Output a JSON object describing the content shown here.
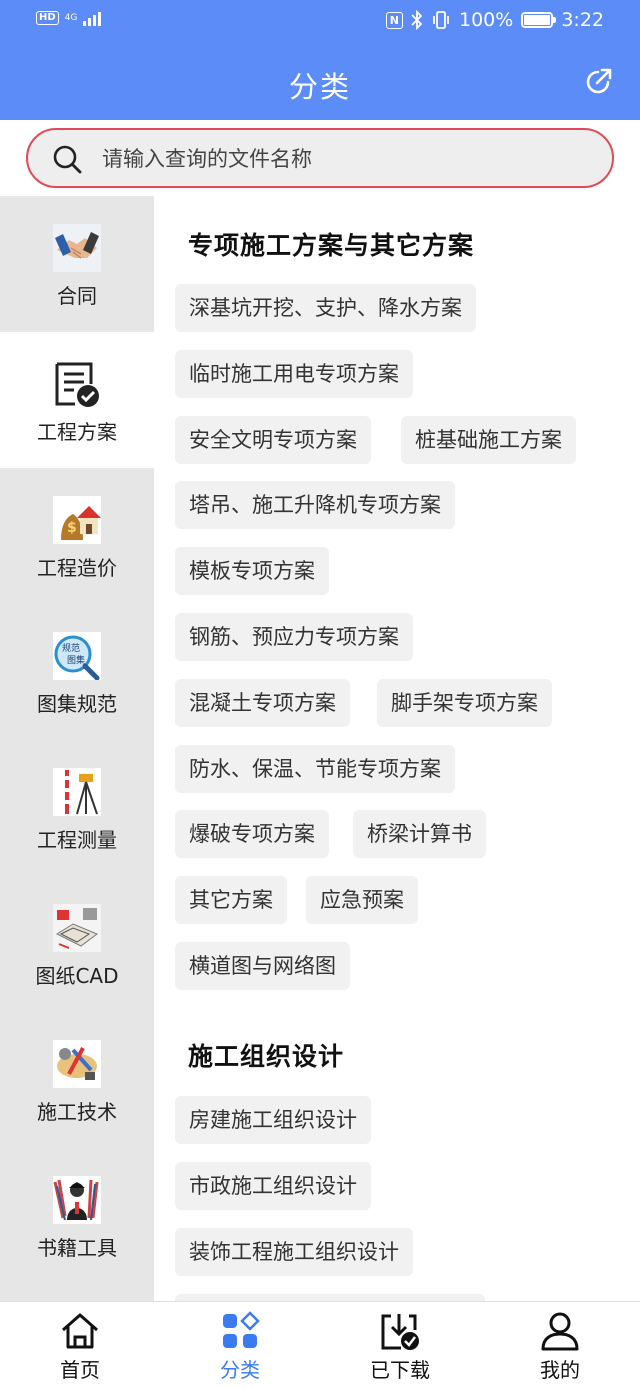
{
  "status_bar": {
    "hd": "HD",
    "network": "4G",
    "battery": "100%",
    "battery_level": 1.0,
    "time": "3:22"
  },
  "header": {
    "title": "分类",
    "share_icon": "share-icon"
  },
  "search": {
    "placeholder": "请输入查询的文件名称",
    "border_color": "#e24a55"
  },
  "sidebar": {
    "items": [
      {
        "label": "合同",
        "icon": "handshake-icon"
      },
      {
        "label": "工程方案",
        "icon": "document-check-icon"
      },
      {
        "label": "工程造价",
        "icon": "money-house-icon"
      },
      {
        "label": "图集规范",
        "icon": "atlas-spec-icon"
      },
      {
        "label": "工程测量",
        "icon": "survey-tripod-icon"
      },
      {
        "label": "图纸CAD",
        "icon": "cad-drawing-icon"
      },
      {
        "label": "施工技术",
        "icon": "construction-tools-icon"
      },
      {
        "label": "书籍工具",
        "icon": "books-icon"
      }
    ],
    "active_index": 1
  },
  "content": {
    "sections": [
      {
        "title": "专项施工方案与其它方案",
        "chips": [
          "深基坑开挖、支护、降水方案",
          "临时施工用电专项方案",
          "安全文明专项方案",
          "桩基础施工方案",
          "塔吊、施工升降机专项方案",
          "模板专项方案",
          "钢筋、预应力专项方案",
          "混凝土专项方案",
          "脚手架专项方案",
          "防水、保温、节能专项方案",
          "爆破专项方案",
          "桥梁计算书",
          "其它方案",
          "应急预案",
          "横道图与网络图"
        ]
      },
      {
        "title": "施工组织设计",
        "chips": [
          "房建施工组织设计",
          "市政施工组织设计",
          "装饰工程施工组织设计"
        ]
      }
    ]
  },
  "bottom_nav": {
    "items": [
      {
        "label": "首页",
        "icon": "home-icon"
      },
      {
        "label": "分类",
        "icon": "category-icon"
      },
      {
        "label": "已下载",
        "icon": "downloaded-icon"
      },
      {
        "label": "我的",
        "icon": "profile-icon"
      }
    ],
    "active_index": 1,
    "active_color": "#3a7cf0"
  },
  "colors": {
    "header_bg": "#5b8cf7",
    "sidebar_bg": "#e6e6e6",
    "chip_bg": "#f1f1f1"
  }
}
